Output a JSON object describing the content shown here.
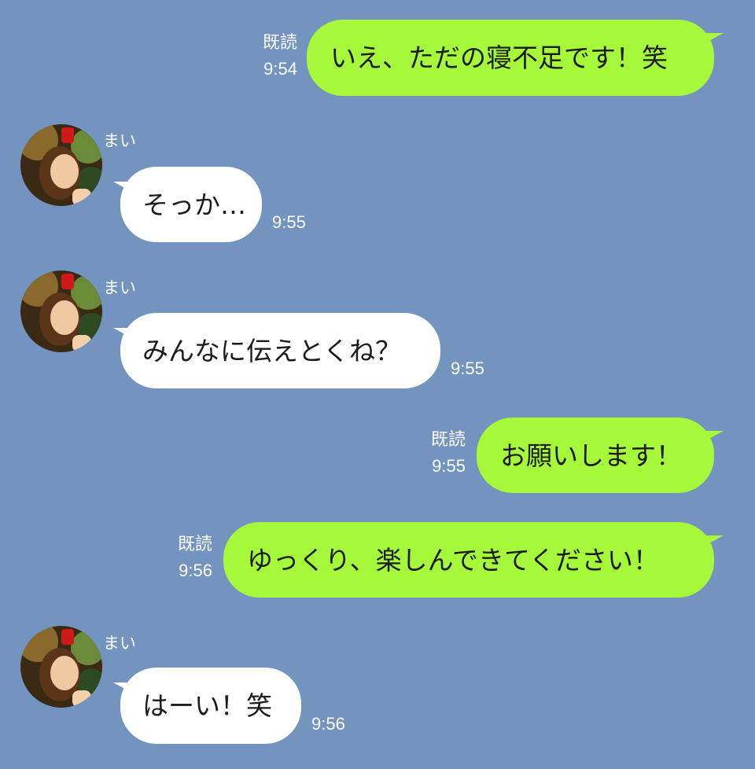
{
  "chat": {
    "messages": [
      {
        "direction": "out",
        "text": "いえ、ただの寝不足です！笑",
        "read_label": "既読",
        "time": "9:54"
      },
      {
        "direction": "in",
        "sender": "まい",
        "text": "そっか…",
        "time": "9:55"
      },
      {
        "direction": "in",
        "sender": "まい",
        "text": "みんなに伝えとくね？",
        "time": "9:55"
      },
      {
        "direction": "out",
        "text": "お願いします！",
        "read_label": "既読",
        "time": "9:55"
      },
      {
        "direction": "out",
        "text": "ゆっくり、楽しんできてください！",
        "read_label": "既読",
        "time": "9:56"
      },
      {
        "direction": "in",
        "sender": "まい",
        "text": "はーい！笑",
        "time": "9:56"
      }
    ]
  },
  "colors": {
    "background": "#7494c0",
    "outgoing_bubble": "#a5f83a",
    "incoming_bubble": "#ffffff"
  },
  "icons": {
    "avatar": "user-avatar-photo"
  }
}
